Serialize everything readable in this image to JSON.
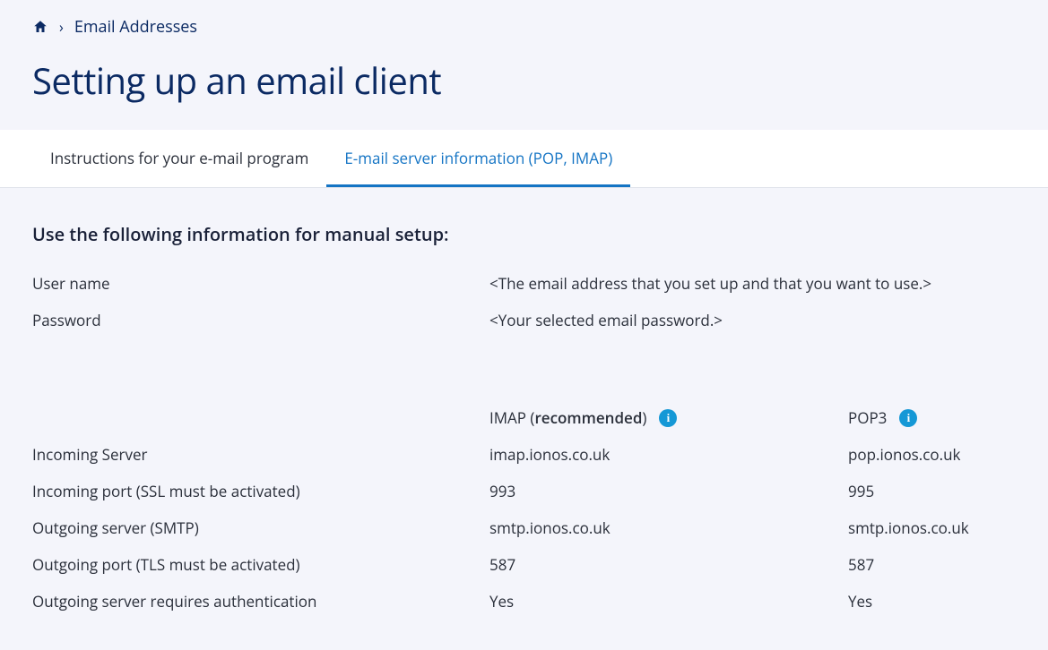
{
  "breadcrumb": {
    "home_label": "Home",
    "email_addresses": "Email Addresses"
  },
  "page_title": "Setting up an email client",
  "tabs": {
    "instructions": "Instructions for your e-mail program",
    "server_info": "E-mail server information (POP, IMAP)"
  },
  "section_heading": "Use the following information for manual setup:",
  "credentials": {
    "username_label": "User name",
    "username_value": "<The email address that you set up and that you want to use.>",
    "password_label": "Password",
    "password_value": "<Your selected email password.>"
  },
  "columns": {
    "imap_prefix": "IMAP (",
    "imap_bold": "recommended",
    "imap_suffix": ")",
    "pop3": "POP3"
  },
  "rows": {
    "incoming_server_label": "Incoming Server",
    "incoming_server_imap": "imap.ionos.co.uk",
    "incoming_server_pop": "pop.ionos.co.uk",
    "incoming_port_label": "Incoming port (SSL must be activated)",
    "incoming_port_imap": "993",
    "incoming_port_pop": "995",
    "outgoing_server_label": "Outgoing server (SMTP)",
    "outgoing_server_imap": "smtp.ionos.co.uk",
    "outgoing_server_pop": "smtp.ionos.co.uk",
    "outgoing_port_label": "Outgoing port (TLS must be activated)",
    "outgoing_port_imap": "587",
    "outgoing_port_pop": "587",
    "auth_label": "Outgoing server requires authentication",
    "auth_imap": "Yes",
    "auth_pop": "Yes"
  }
}
